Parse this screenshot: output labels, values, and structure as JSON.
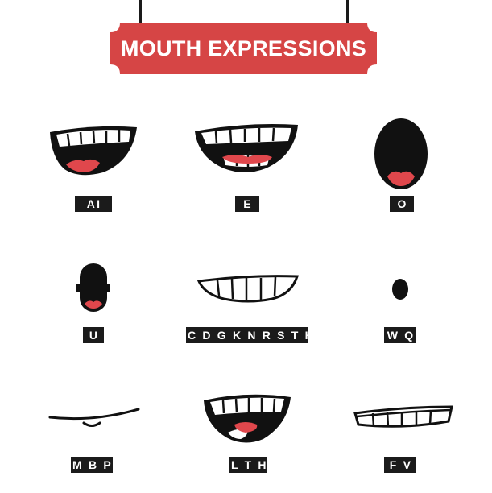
{
  "title": "MOUTH EXPRESSIONS",
  "colors": {
    "sign": "#d64545",
    "ink": "#1b1b1b",
    "tongue": "#e0474c",
    "teeth": "#ffffff"
  },
  "mouths": [
    {
      "label": "AI",
      "icon": "wide-open-smile-mouth-icon"
    },
    {
      "label": "E",
      "icon": "grin-mouth-icon"
    },
    {
      "label": "O",
      "icon": "round-open-mouth-icon"
    },
    {
      "label": "U",
      "icon": "pursed-mouth-icon"
    },
    {
      "label": "C D G K N R S T H Y Z",
      "icon": "clenched-teeth-mouth-icon"
    },
    {
      "label": "W Q",
      "icon": "small-o-mouth-icon"
    },
    {
      "label": "M B P",
      "icon": "closed-line-mouth-icon"
    },
    {
      "label": "L T H",
      "icon": "tongue-up-mouth-icon"
    },
    {
      "label": "F V",
      "icon": "lip-bite-mouth-icon"
    }
  ]
}
